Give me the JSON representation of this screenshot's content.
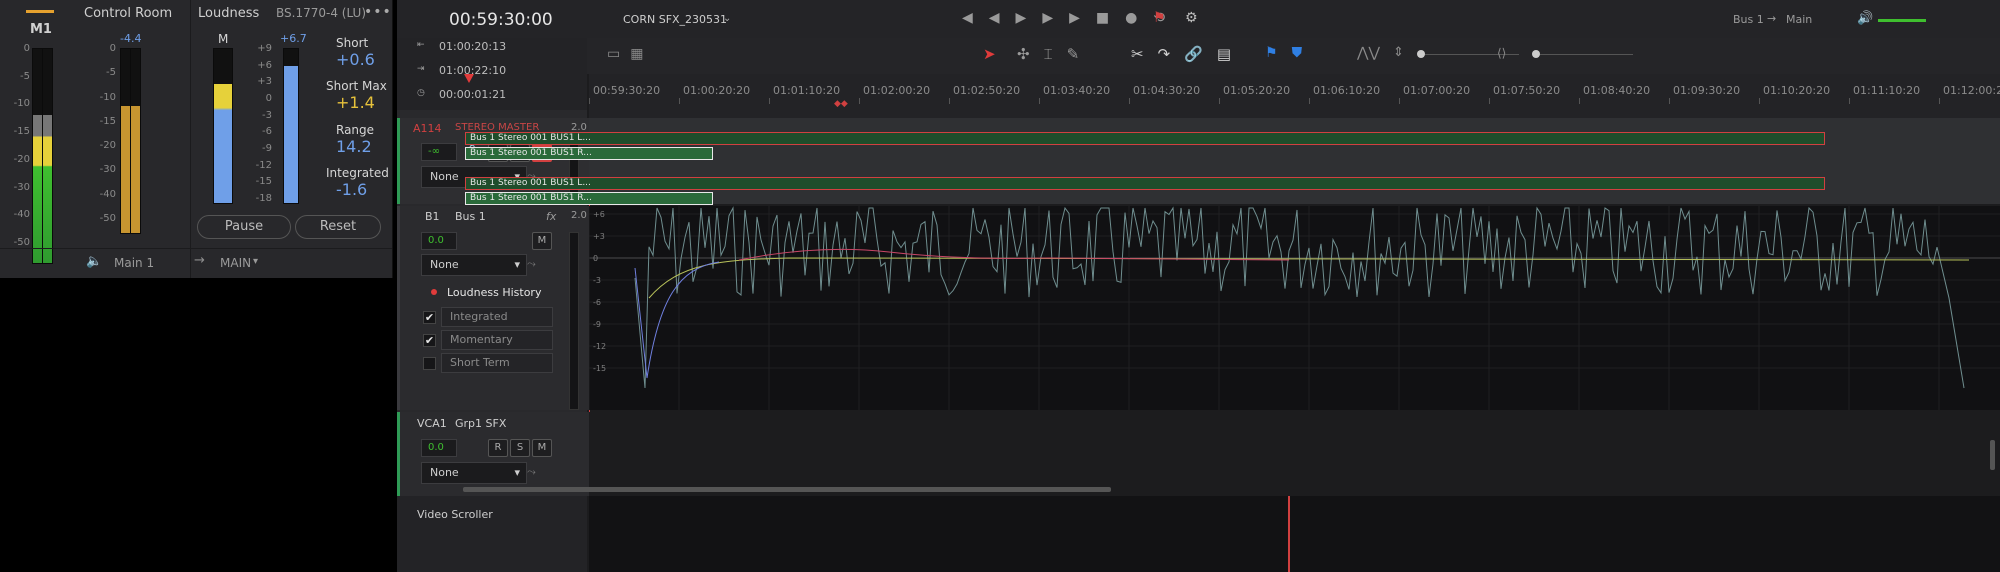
{
  "meters_panel": {
    "m1_label": "M1",
    "control_room_title": "Control Room",
    "loudness_title": "Loudness",
    "standard": "BS.1770-4 (LU)",
    "more_icon": "ellipsis-icon",
    "m1_scale": [
      "0",
      "-5",
      "-10",
      "-15",
      "-20",
      "-30",
      "-40",
      "-50"
    ],
    "cr_peak": "-4.4",
    "cr_scale": [
      "0",
      "-5",
      "-10",
      "-15",
      "-20",
      "-30",
      "-40",
      "-50"
    ],
    "loud_m_label": "M",
    "loud_scale": [
      "+9",
      "+6",
      "+3",
      "0",
      "-3",
      "-6",
      "-9",
      "-12",
      "-15",
      "-18"
    ],
    "loud_peak": "+6.7",
    "short_label": "Short",
    "short_value": "+0.6",
    "short_max_label": "Short Max",
    "short_max_value": "+1.4",
    "range_label": "Range",
    "range_value": "14.2",
    "integrated_label": "Integrated",
    "integrated_value": "-1.6",
    "pause_label": "Pause",
    "reset_label": "Reset",
    "monitor_label": "Main 1",
    "main_out_label": "MAIN",
    "m1_level": 0.7,
    "cr_level": 0.7,
    "loud_level": 0.78,
    "loud_right_level": 0.9
  },
  "transport": {
    "timecode": "00:59:30:00",
    "timeline_name": "CORN SFX_230531",
    "bus_label": "Bus 1",
    "main_label": "Main",
    "tc_in": "01:00:20:13",
    "tc_out": "01:00:22:10",
    "tc_dur": "00:00:01:21"
  },
  "ruler": {
    "labels": [
      "00:59:30:20",
      "01:00:20:20",
      "01:01:10:20",
      "01:02:00:20",
      "01:02:50:20",
      "01:03:40:20",
      "01:04:30:20",
      "01:05:20:20",
      "01:06:10:20",
      "01:07:00:20",
      "01:07:50:20",
      "01:08:40:20",
      "01:09:30:20",
      "01:10:20:20",
      "01:11:10:20",
      "01:12:00:20"
    ]
  },
  "tracks": {
    "a1_id": "A1",
    "a1_num": "14",
    "a1_name": "STEREO MASTER",
    "a1_format": "2.0",
    "a1_vol": "-∞",
    "a1_none": "None",
    "clip1_top": "Bus 1 Stereo  001 BUS1 L...",
    "clip1_bot": "Bus 1 Stereo  001 BUS1 R...",
    "clip2_top": "Bus 1 Stereo  001 BUS1 L...",
    "clip2_bot": "Bus 1 Stereo  001 BUS1 R...",
    "b1_id": "B1",
    "b1_name": "Bus 1",
    "b1_fx": "fx",
    "b1_format": "2.0",
    "b1_vol": "0.0",
    "b1_none": "None",
    "loudness_history": "Loudness History",
    "opt_integrated": "Integrated",
    "opt_momentary": "Momentary",
    "opt_short_term": "Short Term",
    "vca_id": "VCA1",
    "vca_name": "Grp1 SFX",
    "vca_vol": "0.0",
    "vca_none": "None",
    "graph_ylabels": [
      "+6",
      "+3",
      "0",
      "-3",
      "-6",
      "-9",
      "-12",
      "-15"
    ]
  },
  "video_scroller_label": "Video Scroller",
  "colors": {
    "accent_red": "#d14040",
    "meter_green": "#3fbf2f",
    "meter_yellow": "#e6d13a",
    "loud_blue": "#6f9fe8"
  }
}
